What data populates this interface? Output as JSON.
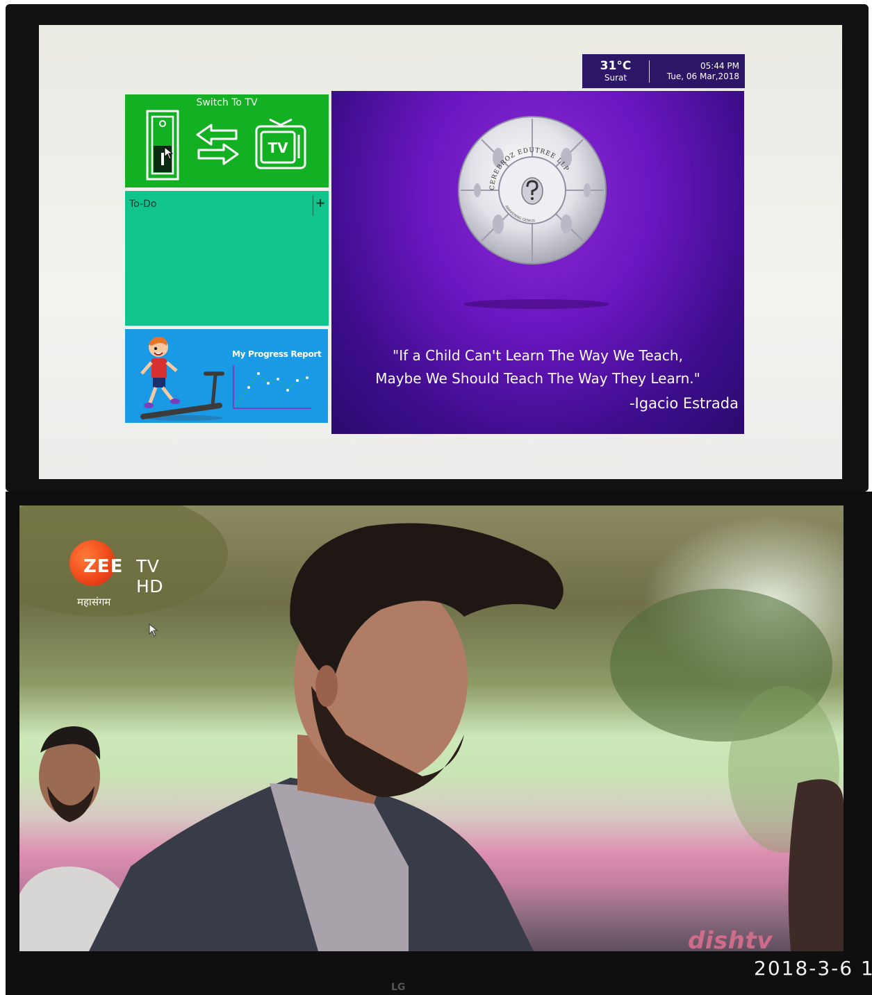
{
  "dashboard": {
    "weather": {
      "temperature": "31°C",
      "city": "Surat"
    },
    "clock": {
      "time": "05:44 PM",
      "date": "Tue, 06 Mar,2018"
    },
    "tiles": {
      "switch_tv": {
        "label": "Switch To TV",
        "tv_icon_text": "TV"
      },
      "todo": {
        "label": "To-Do",
        "add_symbol": "+"
      },
      "progress": {
        "label": "My Progress Report"
      }
    },
    "quote": {
      "line1": "\"If a Child Can't Learn The Way We Teach,",
      "line2": "Maybe We Should Teach The Way They Learn.\"",
      "author": "-Igacio Estrada"
    },
    "logo": {
      "text_top": "CEREBROZ EDUTREE LLP",
      "text_bottom": "AWAKENING GENIUS"
    },
    "colors": {
      "status_bar": "#2b1766",
      "tv_tile": "#12b022",
      "todo_tile": "#10c48c",
      "progress_tile": "#1a9ae4",
      "quote_tile": "#6a16c0"
    }
  },
  "tv": {
    "channel_logo": {
      "zee": "ZEE",
      "tvhd": "TV HD",
      "tagline": "महासंगम"
    },
    "provider_logo": "dishtv",
    "photo_timestamp": "2018-3-6 1",
    "monitor_brand": "LG"
  }
}
